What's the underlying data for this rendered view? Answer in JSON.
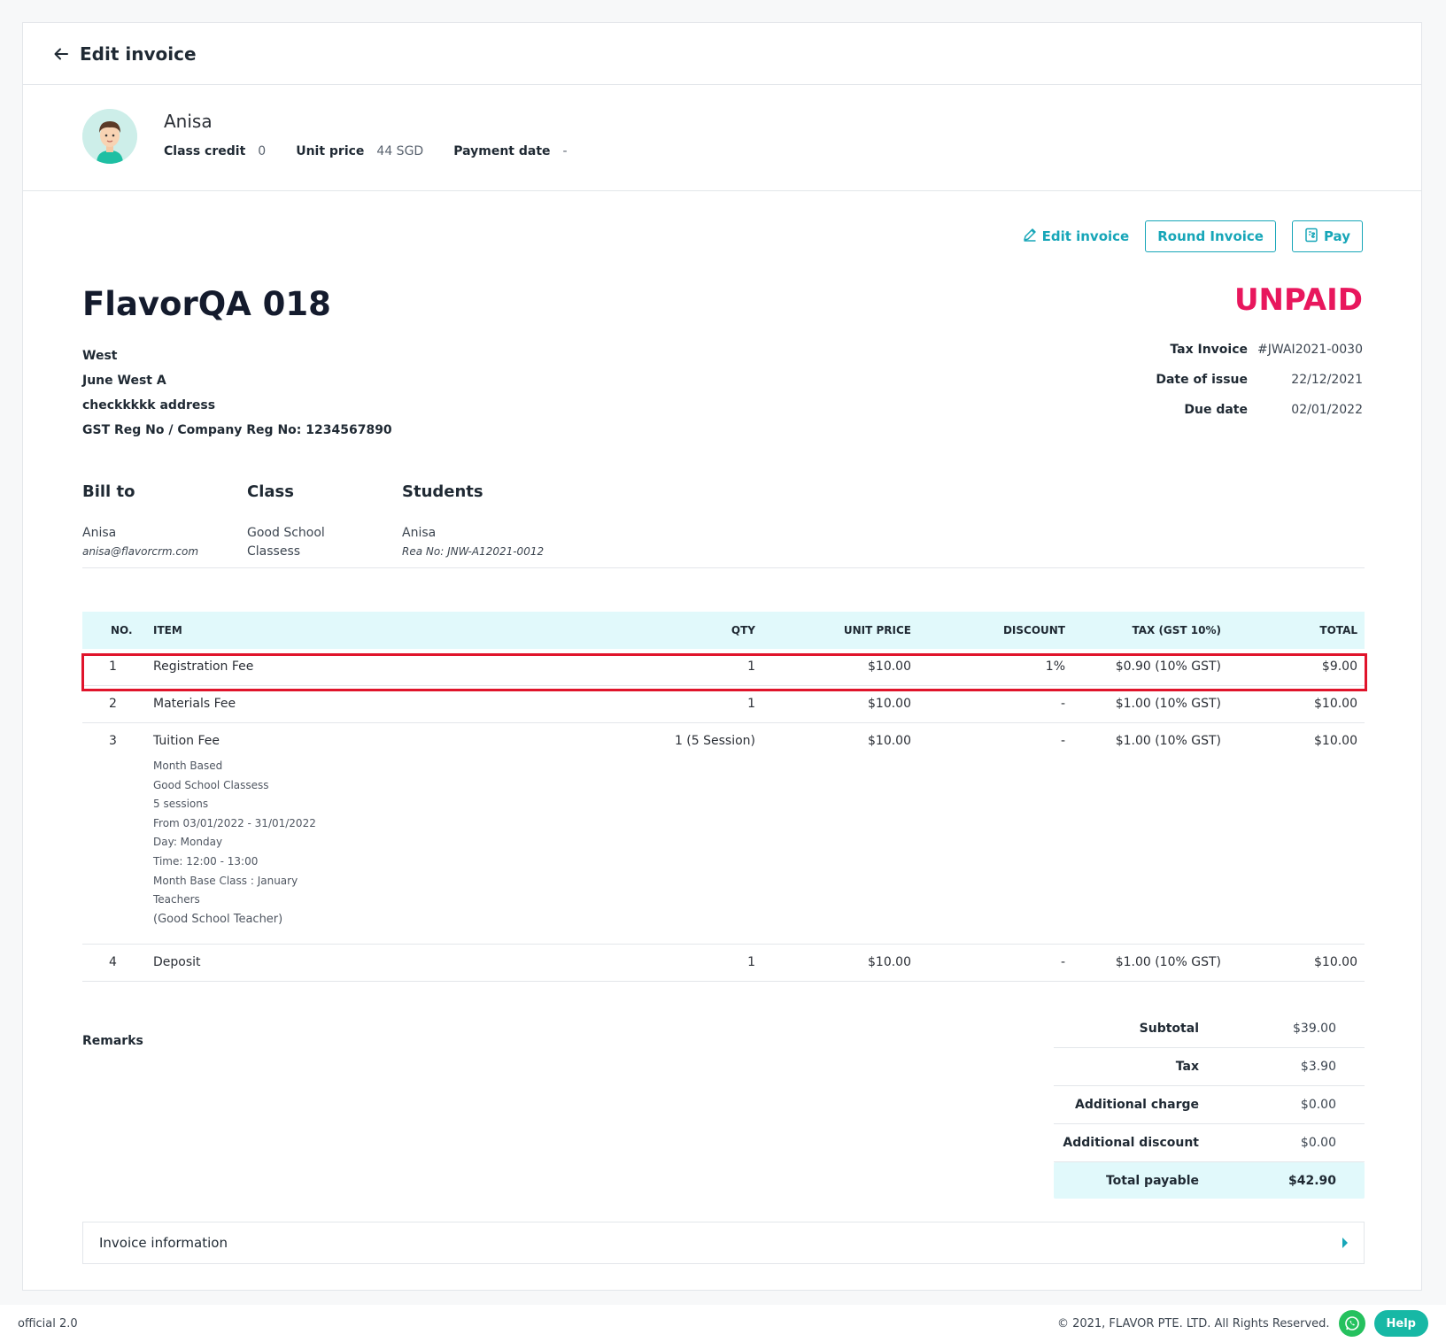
{
  "header": {
    "title": "Edit invoice"
  },
  "profile": {
    "name": "Anisa",
    "class_credit_label": "Class credit",
    "class_credit": "0",
    "unit_price_label": "Unit price",
    "unit_price": "44 SGD",
    "payment_date_label": "Payment date",
    "payment_date": "-"
  },
  "actions": {
    "edit_label": "Edit invoice",
    "round_label": "Round Invoice",
    "pay_label": "Pay"
  },
  "invoice": {
    "company": "FlavorQA 018",
    "status": "UNPAID",
    "status_color": "#e8175d",
    "address": [
      "West",
      "June West A",
      "checkkkkk address",
      "GST Reg No / Company Reg No: 1234567890"
    ],
    "meta": [
      {
        "label": "Tax Invoice",
        "value": "#JWAI2021-0030"
      },
      {
        "label": "Date of issue",
        "value": "22/12/2021"
      },
      {
        "label": "Due date",
        "value": "02/01/2022"
      }
    ]
  },
  "bill": {
    "bill_to_heading": "Bill to",
    "bill_to_name": "Anisa",
    "bill_to_email": "anisa@flavorcrm.com",
    "class_heading": "Class",
    "class_name_1": "Good School",
    "class_name_2": "Classess",
    "students_heading": "Students",
    "student_name": "Anisa",
    "student_reg": "Rea No: JNW-A12021-0012"
  },
  "table": {
    "headers": {
      "no": "NO.",
      "item": "ITEM",
      "qty": "QTY",
      "unit": "UNIT PRICE",
      "disc": "DISCOUNT",
      "tax": "TAX (GST 10%)",
      "total": "TOTAL"
    },
    "rows": [
      {
        "no": "1",
        "item": "Registration Fee",
        "qty": "1",
        "unit": "$10.00",
        "disc": "1%",
        "tax": "$0.90 (10% GST)",
        "total": "$9.00"
      },
      {
        "no": "2",
        "item": "Materials Fee",
        "qty": "1",
        "unit": "$10.00",
        "disc": "-",
        "tax": "$1.00 (10% GST)",
        "total": "$10.00"
      },
      {
        "no": "3",
        "item": "Tuition Fee",
        "qty": "1 (5 Session)",
        "unit": "$10.00",
        "disc": "-",
        "tax": "$1.00 (10% GST)",
        "total": "$10.00",
        "details": [
          "Month Based",
          "Good School Classess",
          "5 sessions",
          "From 03/01/2022 - 31/01/2022",
          "Day: Monday",
          "Time: 12:00 - 13:00",
          "Month Base Class : January",
          "Teachers",
          "(Good School Teacher)"
        ]
      },
      {
        "no": "4",
        "item": "Deposit",
        "qty": "1",
        "unit": "$10.00",
        "disc": "-",
        "tax": "$1.00 (10% GST)",
        "total": "$10.00"
      }
    ]
  },
  "remarks_label": "Remarks",
  "totals": [
    {
      "label": "Subtotal",
      "value": "$39.00"
    },
    {
      "label": "Tax",
      "value": "$3.90"
    },
    {
      "label": "Additional charge",
      "value": "$0.00"
    },
    {
      "label": "Additional discount",
      "value": "$0.00"
    },
    {
      "label": "Total payable",
      "value": "$42.90"
    }
  ],
  "invoice_info_label": "Invoice information",
  "footer": {
    "version": "official 2.0",
    "copyright": "© 2021, FLAVOR PTE. LTD. All Rights Reserved.",
    "help_label": "Help"
  },
  "colors": {
    "accent": "#17a6b8",
    "status": "#e8175d",
    "highlight": "#e0142b",
    "table_header_bg": "#e1f9fb"
  },
  "icons": [
    "arrow-left-icon",
    "avatar-icon",
    "pencil-icon",
    "receipt-icon",
    "chevron-right-icon",
    "whatsapp-icon"
  ]
}
